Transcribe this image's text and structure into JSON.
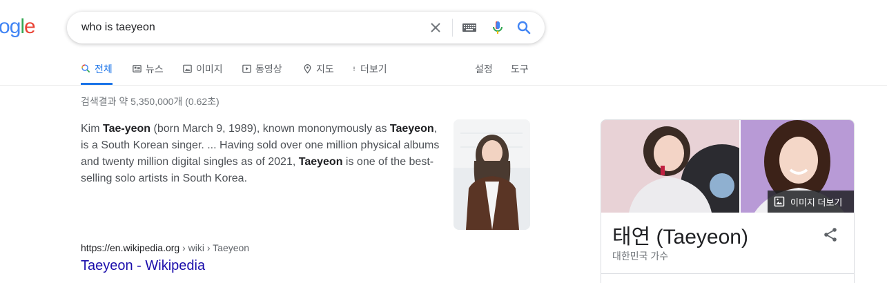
{
  "logo": {
    "text_parts": [
      "o",
      "g",
      "l",
      "e"
    ]
  },
  "search": {
    "query": "who is taeyeon"
  },
  "tabs": [
    {
      "label": "전체",
      "icon": "search-icon"
    },
    {
      "label": "뉴스",
      "icon": "news-icon"
    },
    {
      "label": "이미지",
      "icon": "image-icon"
    },
    {
      "label": "동영상",
      "icon": "video-icon"
    },
    {
      "label": "지도",
      "icon": "map-pin-icon"
    },
    {
      "label": "더보기",
      "icon": "more-vert-icon"
    }
  ],
  "tools": {
    "settings": "설정",
    "tools": "도구"
  },
  "result_stats": "검색결과 약 5,350,000개 (0.62초)",
  "snippet": {
    "p1": "Kim ",
    "b1": "Tae-yeon",
    "p2": " (born March 9, 1989), known mononymously as ",
    "b2": "Taeyeon",
    "p3": ", is a South Korean singer. ... Having sold over one million physical albums and twenty million digital singles as of 2021, ",
    "b3": "Taeyeon",
    "p4": " is one of the best-selling solo artists in South Korea."
  },
  "result": {
    "cite_domain": "https://en.wikipedia.org",
    "cite_path": " › wiki › Taeyeon",
    "title": "Taeyeon - Wikipedia"
  },
  "knowledge_panel": {
    "more_images": "이미지 더보기",
    "title": "태연 (Taeyeon)",
    "subtitle": "대한민국 가수"
  },
  "colors": {
    "accent": "#1a73e8",
    "link": "#1a0dab",
    "google_blue": "#4285f4",
    "google_red": "#ea4335",
    "google_yellow": "#fbbc05",
    "google_green": "#34a853"
  }
}
